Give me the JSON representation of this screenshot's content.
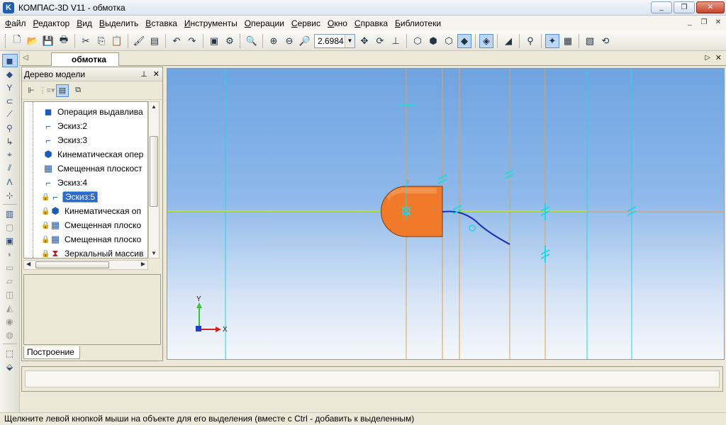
{
  "window": {
    "title": "КОМПАС-3D V11 - обмотка",
    "logo_letter": "K"
  },
  "window_buttons": [
    "_",
    "❐",
    "✕"
  ],
  "menu": [
    {
      "label": "Файл",
      "u": "Ф",
      "rest": "айл"
    },
    {
      "label": "Редактор",
      "u": "Р",
      "rest": "едактор"
    },
    {
      "label": "Вид",
      "u": "В",
      "rest": "ид"
    },
    {
      "label": "Выделить",
      "u": "В",
      "rest": "ыделить"
    },
    {
      "label": "Вставка",
      "u": "В",
      "rest": "ставка"
    },
    {
      "label": "Инструменты",
      "u": "И",
      "rest": "нструменты"
    },
    {
      "label": "Операции",
      "u": "О",
      "rest": "перации"
    },
    {
      "label": "Сервис",
      "u": "С",
      "rest": "ервис"
    },
    {
      "label": "Окно",
      "u": "О",
      "rest": "кно"
    },
    {
      "label": "Справка",
      "u": "С",
      "rest": "правка"
    },
    {
      "label": "Библиотеки",
      "u": "Б",
      "rest": "иблиотеки"
    }
  ],
  "toolbar": {
    "zoom_value": "2.6984"
  },
  "document_tab": {
    "label": "обмотка"
  },
  "tree": {
    "title": "Дерево модели",
    "items": [
      {
        "label": "Операция выдавлива",
        "icon": "extrude-icon",
        "locked": false,
        "selected": false
      },
      {
        "label": "Эскиз:2",
        "icon": "sketch-icon",
        "locked": false,
        "selected": false
      },
      {
        "label": "Эскиз:3",
        "icon": "sketch-icon",
        "locked": false,
        "selected": false
      },
      {
        "label": "Кинематическая опер",
        "icon": "sweep-icon",
        "locked": false,
        "selected": false
      },
      {
        "label": "Смещенная плоскост",
        "icon": "offset-plane-icon",
        "locked": false,
        "selected": false
      },
      {
        "label": "Эскиз:4",
        "icon": "sketch-icon",
        "locked": false,
        "selected": false
      },
      {
        "label": "Эскиз:5",
        "icon": "sketch-icon",
        "locked": true,
        "selected": true
      },
      {
        "label": "Кинематическая оп",
        "icon": "sweep-icon",
        "locked": true,
        "selected": false
      },
      {
        "label": "Смещенная плоско",
        "icon": "offset-plane-icon",
        "locked": true,
        "selected": false
      },
      {
        "label": "Смещенная плоско",
        "icon": "offset-plane-icon",
        "locked": true,
        "selected": false
      },
      {
        "label": "Зеркальный массив",
        "icon": "mirror-array-icon",
        "locked": true,
        "selected": false
      }
    ],
    "bottom_tab": "Построение"
  },
  "viewport": {
    "axis_x_label": "X",
    "axis_y_label": "Y",
    "colors": {
      "part": "#f07a2a",
      "curve": "#1a2fb0",
      "guide_orange": "#e0a050",
      "guide_cyan": "#25d6e0",
      "horizon": "#b6e03a"
    }
  },
  "status": {
    "text": "Щелкните левой кнопкой мыши на объекте для его выделения (вместе с Ctrl - добавить к выделенным)"
  }
}
